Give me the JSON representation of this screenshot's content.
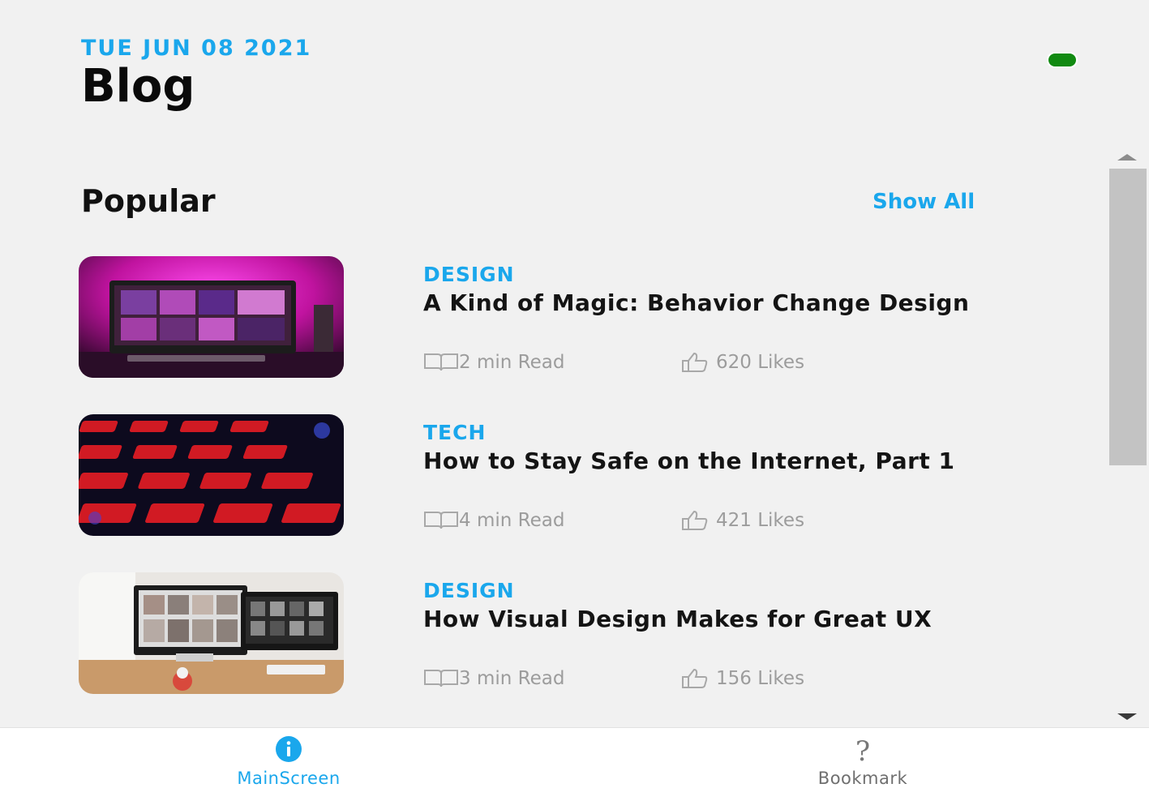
{
  "header": {
    "date": "TUE JUN 08 2021",
    "title": "Blog",
    "status_color": "#118a11"
  },
  "popular": {
    "section_title": "Popular",
    "show_all_label": "Show All",
    "posts": [
      {
        "category": "DESIGN",
        "title": "A Kind of Magic: Behavior Change Design",
        "read_time": "2 min Read",
        "likes": "620 Likes",
        "image": "pink-lit-desktop-monitor"
      },
      {
        "category": "TECH",
        "title": "How to Stay Safe on the Internet, Part 1",
        "read_time": "4 min Read",
        "likes": "421 Likes",
        "image": "red-backlit-keyboard"
      },
      {
        "category": "DESIGN",
        "title": "How Visual Design Makes for Great UX",
        "read_time": "3 min Read",
        "likes": "156 Likes",
        "image": "two-monitors-on-desk"
      }
    ]
  },
  "tabbar": {
    "tabs": [
      {
        "label": "MainScreen",
        "icon": "info-icon",
        "active": true
      },
      {
        "label": "Bookmark",
        "icon": "question-icon",
        "active": false
      }
    ]
  },
  "colors": {
    "accent": "#1aa7ec",
    "background": "#f1f1f1",
    "muted_text": "#9c9c9c"
  }
}
